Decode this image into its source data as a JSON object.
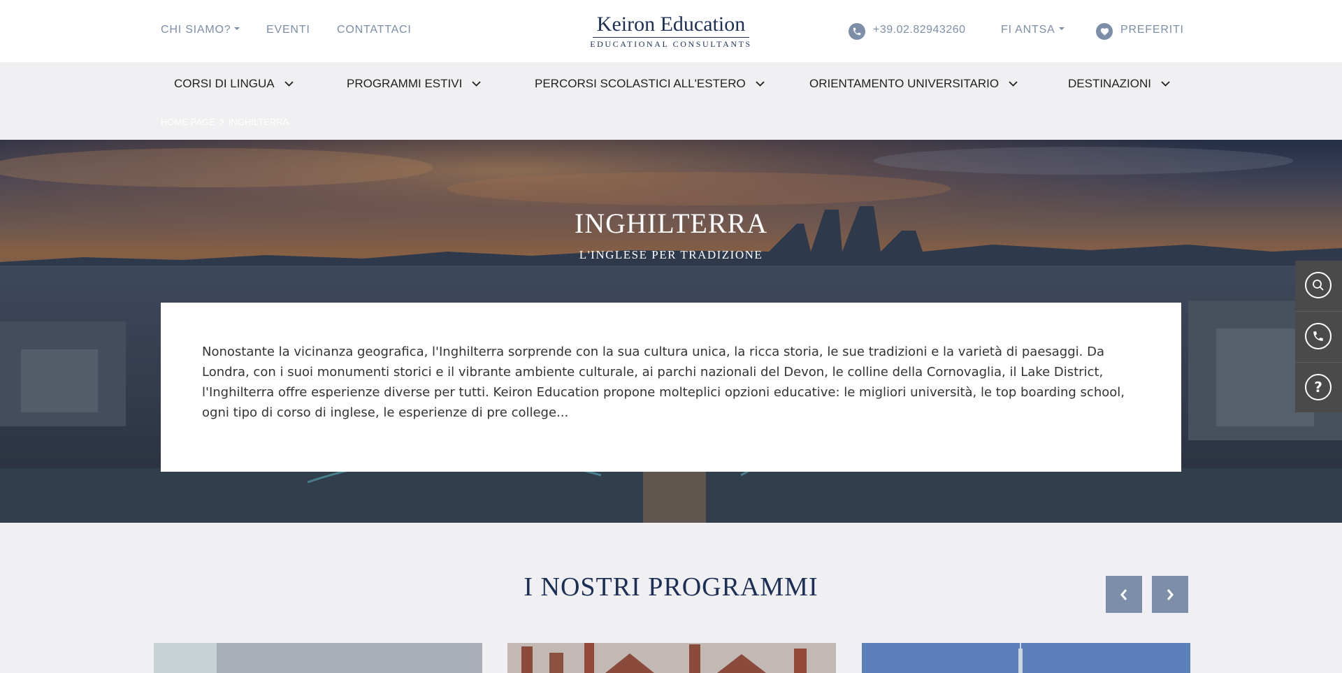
{
  "header": {
    "chi_siamo": "CHI SIAMO?",
    "eventi": "EVENTI",
    "contattaci": "CONTATTACI",
    "logo_title": "Keiron Education",
    "logo_subtitle": "EDUCATIONAL CONSULTANTS",
    "phone": "+39.02.82943260",
    "user": "FI ANTSA",
    "preferiti": "PREFERITI",
    "icons": {
      "phone": "phone-icon",
      "favorites": "heart-icon"
    }
  },
  "nav": {
    "items": [
      {
        "label": "CORSI DI LINGUA"
      },
      {
        "label": "PROGRAMMI ESTIVI"
      },
      {
        "label": "PERCORSI SCOLASTICI ALL'ESTERO"
      },
      {
        "label": "ORIENTAMENTO UNIVERSITARIO"
      },
      {
        "label": "DESTINAZIONI"
      }
    ]
  },
  "breadcrumb": {
    "home": "HOME PAGE",
    "current": "INGHILTERRA"
  },
  "hero": {
    "title": "INGHILTERRA",
    "subtitle": "L'INGLESE PER TRADIZIONE",
    "intro": "Nonostante la vicinanza geografica, l'Inghilterra sorprende con la sua cultura unica, la ricca storia, le sue tradizioni e la varietà di paesaggi. Da Londra, con i suoi monumenti storici e il vibrante ambiente culturale, ai parchi nazionali del Devon, le colline della Cornovaglia, il Lake District, l'Inghilterra offre esperienze diverse per tutti. Keiron Education propone molteplici opzioni educative: le migliori università, le top boarding school, ogni tipo di corso di inglese, le esperienze di pre college..."
  },
  "side_widget": {
    "icons": [
      "search-icon",
      "phone-icon",
      "help-icon"
    ]
  },
  "programmi": {
    "title": "I NOSTRI PROGRAMMI",
    "icons": {
      "prev": "chevron-left-icon",
      "next": "chevron-right-icon"
    }
  },
  "colors": {
    "navy": "#1c2f56",
    "muted_blue": "#7d8ea8",
    "background": "#f0f0f2",
    "side_widget": "#4a4a4a"
  }
}
